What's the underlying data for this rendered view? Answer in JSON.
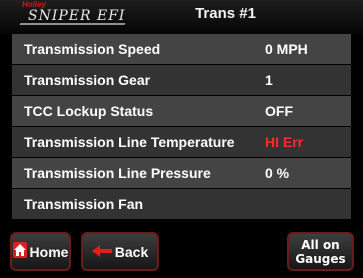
{
  "header": {
    "brand_small": "Holley",
    "brand": "SNIPER EFI",
    "title": "Trans #1"
  },
  "rows": [
    {
      "label": "Transmission Speed",
      "value": "0 MPH",
      "status": "normal"
    },
    {
      "label": "Transmission Gear",
      "value": "1",
      "status": "normal"
    },
    {
      "label": "TCC Lockup Status",
      "value": "OFF",
      "status": "normal"
    },
    {
      "label": "Transmission Line Temperature",
      "value": "HI Err",
      "status": "error"
    },
    {
      "label": "Transmission Line Pressure",
      "value": "0 %",
      "status": "normal"
    },
    {
      "label": "Transmission Fan",
      "value": "",
      "status": "normal"
    }
  ],
  "buttons": {
    "home": {
      "label": "Home",
      "icon": "home-icon"
    },
    "back": {
      "label": "Back",
      "icon": "arrow-left-icon"
    },
    "all_gauges": {
      "line1": "All on",
      "line2": "Gauges"
    }
  },
  "colors": {
    "error": "#ff2a2a",
    "icon_red": "#e01e1e",
    "button_border": "#6a1c1c"
  }
}
